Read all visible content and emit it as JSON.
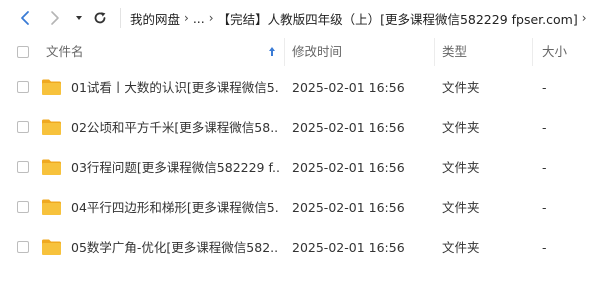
{
  "toolbar": {
    "back_icon": "chevron-left-icon",
    "forward_icon": "chevron-right-icon",
    "dropdown_icon": "caret-down-icon",
    "refresh_icon": "refresh-icon",
    "accent": "#3a7bd5"
  },
  "breadcrumb": {
    "root": "我的网盘",
    "ellipsis": "...",
    "current": "【完结】人教版四年级（上）[更多课程微信582229 fpser.com]",
    "separator": "›"
  },
  "columns": {
    "name": "文件名",
    "modified": "修改时间",
    "type": "类型",
    "size": "大小",
    "sort_icon": "sort-ascending-icon"
  },
  "files": [
    {
      "name": "01试看丨大数的认识[更多课程微信5...",
      "modified": "2025-02-01 16:56",
      "type": "文件夹",
      "size": "-"
    },
    {
      "name": "02公顷和平方千米[更多课程微信58...",
      "modified": "2025-02-01 16:56",
      "type": "文件夹",
      "size": "-"
    },
    {
      "name": "03行程问题[更多课程微信582229 f...",
      "modified": "2025-02-01 16:56",
      "type": "文件夹",
      "size": "-"
    },
    {
      "name": "04平行四边形和梯形[更多课程微信5...",
      "modified": "2025-02-01 16:56",
      "type": "文件夹",
      "size": "-"
    },
    {
      "name": "05数学广角-优化[更多课程微信582...",
      "modified": "2025-02-01 16:56",
      "type": "文件夹",
      "size": "-"
    }
  ],
  "colors": {
    "folder": "#f7c23c",
    "folder_dark": "#f0a91f",
    "sort_arrow": "#3a7bd5"
  }
}
